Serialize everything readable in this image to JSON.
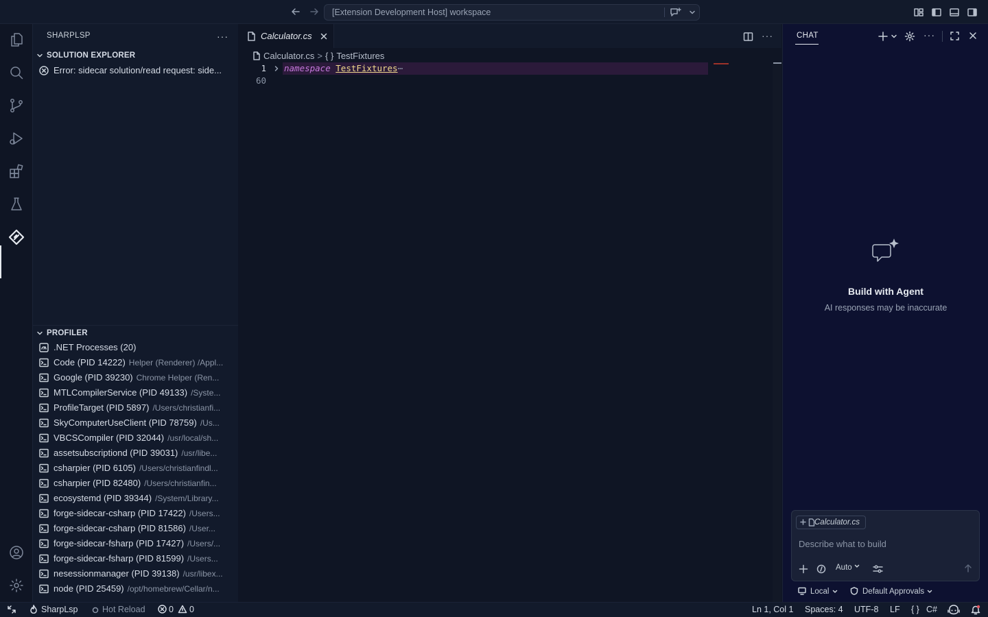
{
  "titlebar": {
    "command_center": "[Extension Development Host] workspace"
  },
  "sidebar": {
    "title": "SHARPLSP",
    "more": "···",
    "solution_explorer": {
      "title": "SOLUTION EXPLORER",
      "error": "Error: sidecar solution/read request: side..."
    },
    "profiler": {
      "title": "PROFILER",
      "root": ".NET Processes (20)",
      "processes": [
        {
          "name": "Code (PID 14222)",
          "desc": "Helper (Renderer) /Appl..."
        },
        {
          "name": "Google (PID 39230)",
          "desc": "Chrome Helper (Ren..."
        },
        {
          "name": "MTLCompilerService (PID 49133)",
          "desc": "/Syste..."
        },
        {
          "name": "ProfileTarget (PID 5897)",
          "desc": "/Users/christianfi..."
        },
        {
          "name": "SkyComputerUseClient (PID 78759)",
          "desc": "/Us..."
        },
        {
          "name": "VBCSCompiler (PID 32044)",
          "desc": "/usr/local/sh..."
        },
        {
          "name": "assetsubscriptiond (PID 39031)",
          "desc": "/usr/libe..."
        },
        {
          "name": "csharpier (PID 6105)",
          "desc": "/Users/christianfindl..."
        },
        {
          "name": "csharpier (PID 82480)",
          "desc": "/Users/christianfin..."
        },
        {
          "name": "ecosystemd (PID 39344)",
          "desc": "/System/Library..."
        },
        {
          "name": "forge-sidecar-csharp (PID 17422)",
          "desc": "/Users..."
        },
        {
          "name": "forge-sidecar-csharp (PID 81586)",
          "desc": "/User..."
        },
        {
          "name": "forge-sidecar-fsharp (PID 17427)",
          "desc": "/Users/..."
        },
        {
          "name": "forge-sidecar-fsharp (PID 81599)",
          "desc": "/Users..."
        },
        {
          "name": "nesessionmanager (PID 39138)",
          "desc": "/usr/libex..."
        },
        {
          "name": "node (PID 25459)",
          "desc": "/opt/homebrew/Cellar/n..."
        }
      ]
    }
  },
  "editor": {
    "tab_label": "Calculator.cs",
    "breadcrumb": {
      "file": "Calculator.cs",
      "symbol_icon": "{ }",
      "symbol": "TestFixtures"
    },
    "line_numbers": [
      "1",
      "60"
    ],
    "code": {
      "keyword": "namespace",
      "name": "TestFixtures",
      "fold": "⋯"
    }
  },
  "chat": {
    "tab": "CHAT",
    "hero_title": "Build with Agent",
    "hero_subtitle": "AI responses may be inaccurate",
    "context_file": "Calculator.cs",
    "input_placeholder": "Describe what to build",
    "mode": "Auto",
    "footer_left": "Local",
    "footer_right": "Default Approvals"
  },
  "statusbar": {
    "project": "SharpLsp",
    "hot_reload": "Hot Reload",
    "errors": "0",
    "warnings": "0",
    "position": "Ln 1, Col 1",
    "spaces": "Spaces: 4",
    "encoding": "UTF-8",
    "eol": "LF",
    "braces": "{ }",
    "language": "C#"
  }
}
